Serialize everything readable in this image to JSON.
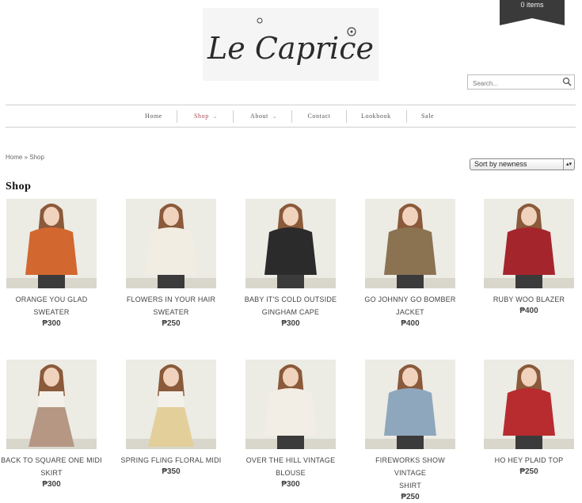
{
  "cart": {
    "label": "0 items"
  },
  "logo": {
    "text": "Le Caprice"
  },
  "search": {
    "placeholder": "Search..."
  },
  "nav": [
    {
      "label": "Home",
      "has_dropdown": false,
      "active": false
    },
    {
      "label": "Shop",
      "has_dropdown": true,
      "active": true
    },
    {
      "label": "About",
      "has_dropdown": true,
      "active": false
    },
    {
      "label": "Contact",
      "has_dropdown": false,
      "active": false
    },
    {
      "label": "Lookbook",
      "has_dropdown": false,
      "active": false
    },
    {
      "label": "Sale",
      "has_dropdown": false,
      "active": false
    }
  ],
  "breadcrumb": {
    "home": "Home",
    "separator": " » ",
    "current": "Shop"
  },
  "sort": {
    "selected": "Sort by newness"
  },
  "page_title": "Shop",
  "products": [
    {
      "line1": "ORANGE YOU GLAD",
      "line2": "SWEATER",
      "price": "₱300"
    },
    {
      "line1": "FLOWERS IN YOUR HAIR",
      "line2": "SWEATER",
      "price": "₱250"
    },
    {
      "line1": "BABY IT'S COLD OUTSIDE",
      "line2": "GINGHAM CAPE",
      "price": "₱300"
    },
    {
      "line1": "GO JOHNNY GO BOMBER",
      "line2": "JACKET",
      "price": "₱400"
    },
    {
      "line1": "RUBY WOO BLAZER",
      "line2": "",
      "price": "₱400"
    },
    {
      "line1": "BACK TO SQUARE ONE MIDI",
      "line2": "SKIRT",
      "price": "₱300"
    },
    {
      "line1": "SPRING FLING FLORAL MIDI",
      "line2": "",
      "price": "₱350"
    },
    {
      "line1": "OVER THE HILL VINTAGE",
      "line2": "BLOUSE",
      "price": "₱300"
    },
    {
      "line1": "FIREWORKS SHOW VINTAGE",
      "line2": "SHIRT",
      "price": "₱250"
    },
    {
      "line1": "HO HEY PLAID TOP",
      "line2": "",
      "price": "₱250"
    }
  ],
  "colors": {
    "active_nav": "#a74b55",
    "cart_bg": "#3a3a3a",
    "garments": [
      "#d2672f",
      "#f1ede3",
      "#2b2b2b",
      "#8b7352",
      "#a5252d",
      "#b59784",
      "#e2cf9a",
      "#f2eee5",
      "#8fa7bd",
      "#b82b2e"
    ]
  }
}
